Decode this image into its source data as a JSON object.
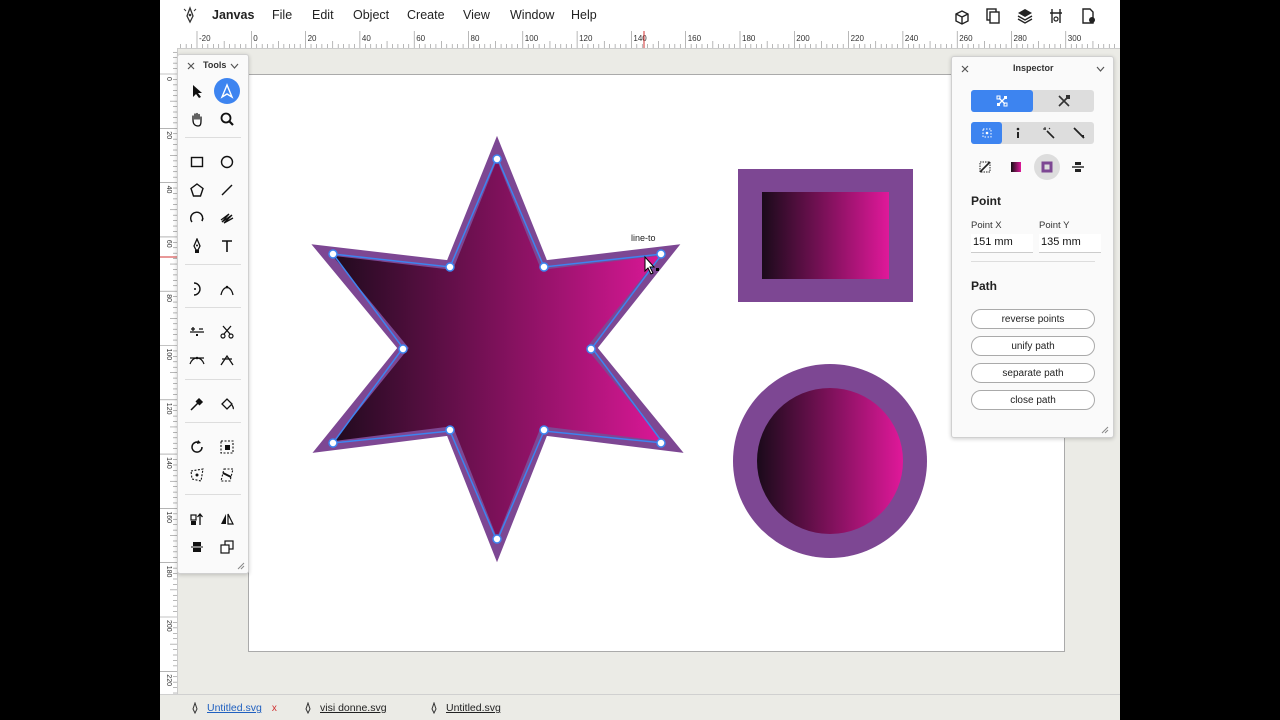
{
  "app": {
    "name": "Janvas",
    "menu": [
      "File",
      "Edit",
      "Object",
      "Create",
      "View",
      "Window",
      "Help"
    ]
  },
  "toolbar_icons": [
    "clipboard-box-icon",
    "copy-pages-icon",
    "layers-icon",
    "transform-anchor-icon",
    "document-settings-icon"
  ],
  "rulers": {
    "horizontal_labels": [
      "-20",
      "0",
      "20",
      "40",
      "60",
      "80",
      "100",
      "120",
      "140",
      "160",
      "180",
      "200",
      "220",
      "240",
      "260",
      "280",
      "300"
    ],
    "vertical_labels": [
      "0",
      "20",
      "40",
      "60",
      "80",
      "100",
      "120",
      "140",
      "160",
      "180",
      "200",
      "220"
    ]
  },
  "tools_panel": {
    "title": "Tools",
    "tools": [
      "selection-arrow-icon",
      "direct-selection-icon",
      "hand-icon",
      "zoom-icon",
      "rectangle-icon",
      "ellipse-icon",
      "polygon-icon",
      "line-icon",
      "arc-icon",
      "freehand-icon",
      "pen-icon",
      "text-icon",
      "half-circle-icon",
      "curve-tool-icon",
      "add-remove-point-icon",
      "scissors-icon",
      "smooth-point-icon",
      "corner-point-icon",
      "eyedropper-icon",
      "paint-bucket-icon",
      "rotate-icon",
      "scale-icon",
      "distort-icon",
      "shear-icon",
      "align-top-icon",
      "reflect-icon",
      "align-center-icon",
      "duplicate-icon"
    ],
    "active_tool": "direct-selection-icon"
  },
  "canvas": {
    "hover_label": "line-to",
    "colors": {
      "gradient_start": "#1a0a1a",
      "gradient_end": "#e0189a",
      "stroke_purple": "#7d4793",
      "selection_blue": "#3d84f0"
    }
  },
  "inspector": {
    "title": "Inspector",
    "mode_tabs": [
      "point-mode-icon",
      "edit-mode-icon"
    ],
    "sub_tabs": [
      "points-select-icon",
      "info-icon",
      "magic-wand-icon",
      "pen-nib-icon"
    ],
    "fill_modes": [
      "no-fill-icon",
      "gradient-fill-icon",
      "stroke-fill-icon",
      "distribute-icon"
    ],
    "point_section": {
      "title": "Point",
      "x_label": "Point X",
      "x_value": "151 mm",
      "y_label": "Point Y",
      "y_value": "135 mm"
    },
    "path_section": {
      "title": "Path",
      "buttons": [
        "reverse points",
        "unify path",
        "separate path",
        "close path"
      ]
    }
  },
  "tabs": [
    {
      "label": "Untitled.svg",
      "active": true,
      "close": "x"
    },
    {
      "label": "visi donne.svg",
      "active": false
    },
    {
      "label": "Untitled.svg",
      "active": false
    }
  ]
}
